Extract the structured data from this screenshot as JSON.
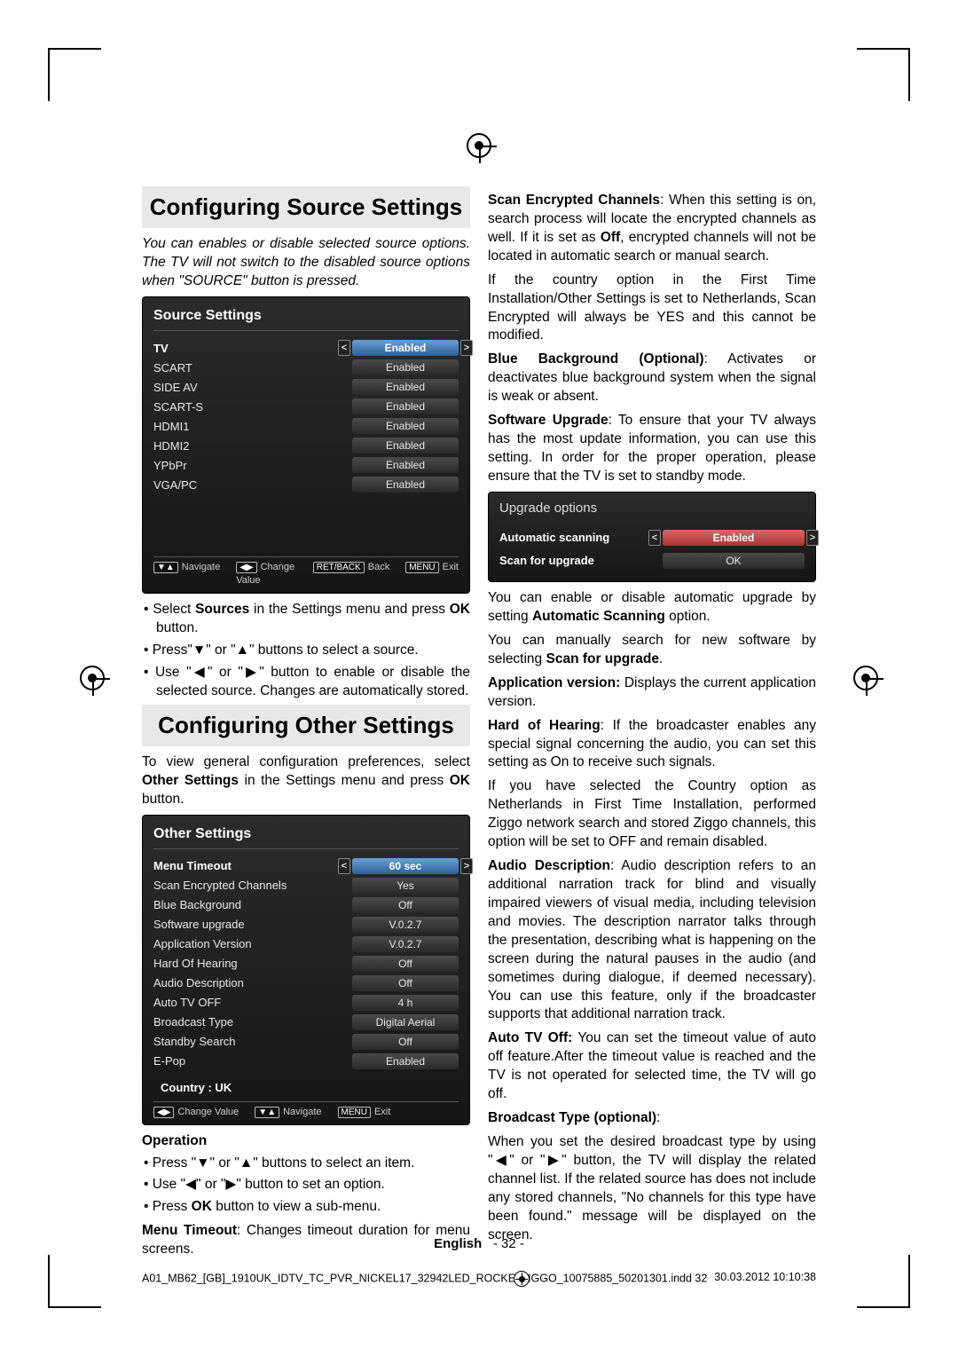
{
  "headings": {
    "source": "Configuring Source Settings",
    "other": "Configuring Other Settings"
  },
  "intro_source": "You can enables or disable selected source options. The TV will not switch to the disabled source options when \"SOURCE\" button is pressed.",
  "osd_source": {
    "title": "Source Settings",
    "rows": [
      {
        "k": "TV",
        "v": "Enabled",
        "sel": true
      },
      {
        "k": "SCART",
        "v": "Enabled"
      },
      {
        "k": "SIDE AV",
        "v": "Enabled"
      },
      {
        "k": "SCART-S",
        "v": "Enabled"
      },
      {
        "k": "HDMI1",
        "v": "Enabled"
      },
      {
        "k": "HDMI2",
        "v": "Enabled"
      },
      {
        "k": "YPbPr",
        "v": "Enabled"
      },
      {
        "k": "VGA/PC",
        "v": "Enabled"
      }
    ],
    "footer": {
      "nav": "Navigate",
      "chg": "Change Value",
      "back": "Back",
      "exit": "Exit",
      "retback": "RET/BACK",
      "menu": "MENU"
    }
  },
  "bul_source": [
    "Select <b>Sources</b> in the Settings menu and press <b>OK</b> button.",
    "Press\"▼\" or \"▲\" buttons to select a source.",
    "Use \"◀\" or \"▶\" button to enable or disable the selected source. Changes are automatically stored."
  ],
  "intro_other_1": "To view general configuration preferences, select <b>Other Settings</b> in the Settings menu and press <b>OK</b> button.",
  "osd_other": {
    "title": "Other Settings",
    "rows": [
      {
        "k": "Menu Timeout",
        "v": "60 sec",
        "sel": true
      },
      {
        "k": "Scan Encrypted Channels",
        "v": "Yes"
      },
      {
        "k": "Blue Background",
        "v": "Off"
      },
      {
        "k": "Software upgrade",
        "v": "V.0.2.7"
      },
      {
        "k": "Application Version",
        "v": "V.0.2.7"
      },
      {
        "k": "Hard Of Hearing",
        "v": "Off"
      },
      {
        "k": "Audio Description",
        "v": "Off"
      },
      {
        "k": "Auto TV OFF",
        "v": "4 h"
      },
      {
        "k": "Broadcast Type",
        "v": "Digital Aerial"
      },
      {
        "k": "Standby Search",
        "v": "Off"
      },
      {
        "k": "E-Pop",
        "v": "Enabled"
      }
    ],
    "country": "Country : UK",
    "footer": {
      "chg": "Change Value",
      "nav": "Navigate",
      "exit": "Exit",
      "menu": "MENU"
    }
  },
  "operation_head": "Operation",
  "bul_op": [
    "Press \"▼\" or \"▲\" buttons to select an item.",
    "Use \"◀\" or \"▶\" button to set an option.",
    "Press <b>OK</b> button to view a sub-menu."
  ],
  "p_menu_timeout": "<b>Menu Timeout</b>: Changes timeout duration for menu screens.",
  "p_scan_enc": "<b>Scan Encrypted Channels</b>: When this setting is on, search process will locate the encrypted channels as well. If it is set as <b>Off</b>, encrypted channels will not be located in automatic search or manual search.",
  "p_country": "If the country option in the First Time Installation/Other Settings is set to Netherlands, Scan Encrypted will always be YES and this cannot be modified.",
  "p_blue": "<b>Blue Background (Optional)</b>: Activates or deactivates blue background system when the signal is weak or absent.",
  "p_sw": "<b>Software Upgrade</b>: To ensure that your TV always has the most update information, you can use this setting. In order for the proper operation, please ensure that the TV is set to standby mode.",
  "osd_upgrade": {
    "title": "Upgrade options",
    "row1": {
      "k": "Automatic scanning",
      "v": "Enabled"
    },
    "row2": {
      "k": "Scan for upgrade",
      "v": "OK"
    }
  },
  "p_auto_upg": "You can enable or disable automatic upgrade by setting <b>Automatic Scanning</b> option.",
  "p_manual": "You can manually search for new software by selecting <b>Scan for upgrade</b>.",
  "p_app": "<b>Application version:</b> Displays the current application version.",
  "p_hoh": "<b>Hard of Hearing</b>: If the broadcaster enables any special signal concerning the audio, you can set this setting as On to receive such signals.",
  "p_nl": "If you have selected the Country option as Netherlands in First Time Installation, performed Ziggo network search and stored Ziggo channels, this option will be set to OFF and remain disabled.",
  "p_ad": "<b>Audio Description</b>: Audio description refers to an additional narration track for blind and visually impaired viewers of visual media, including television and movies. The description narrator talks through the presentation, describing what is happening on the screen during the natural pauses in the audio (and sometimes during dialogue, if deemed necessary). You can use this feature, only if the broadcaster supports that additional narration track.",
  "p_atv": "<b>Auto TV Off:</b> You can set the timeout value of auto off feature.After the timeout value is reached and the TV is not operated for selected time, the TV will go off.",
  "p_bt_head": "<b>Broadcast Type (optional)</b>:",
  "p_bt": "When you set the desired broadcast type by using \"◀\" or \"▶\" button, the TV will display the related channel list. If the related source has does not include any stored channels, \"No channels for this type have been found.\" message will be displayed on the screen.",
  "footer": {
    "lang": "English",
    "page": "- 32 -"
  },
  "indd": {
    "file": "A01_MB62_[GB]_1910UK_IDTV_TC_PVR_NICKEL17_32942LED_ROCKE",
    "file2": "IGGO_10075885_50201301.indd   32",
    "ts": "30.03.2012   10:10:38"
  }
}
